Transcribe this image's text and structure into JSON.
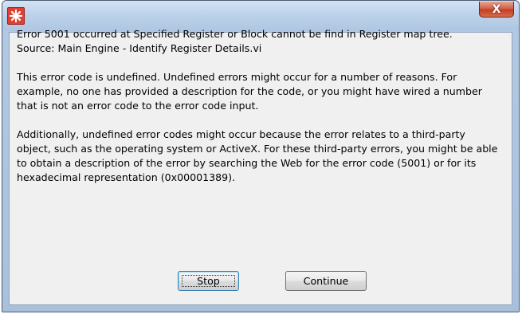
{
  "window": {
    "close_glyph": "X",
    "icon": "labview-icon"
  },
  "message": {
    "line1": "Error 5001 occurred at Specified Register or Block cannot be find in Register map tree.",
    "source": "Source: Main Engine - Identify Register Details.vi",
    "para2": "This error code is undefined. Undefined errors might occur for a number of reasons. For example, no one has provided a description for the code, or you might have wired a number that is not an error code to the error code input.",
    "para3": "Additionally, undefined error codes might occur because the error relates to a third-party object, such as the operating system or ActiveX. For these third-party errors, you might be able to obtain a description of the error by searching the Web for the error code (5001) or for its hexadecimal representation (0x00001389)."
  },
  "buttons": {
    "stop_label": "Stop",
    "continue_label": "Continue"
  }
}
